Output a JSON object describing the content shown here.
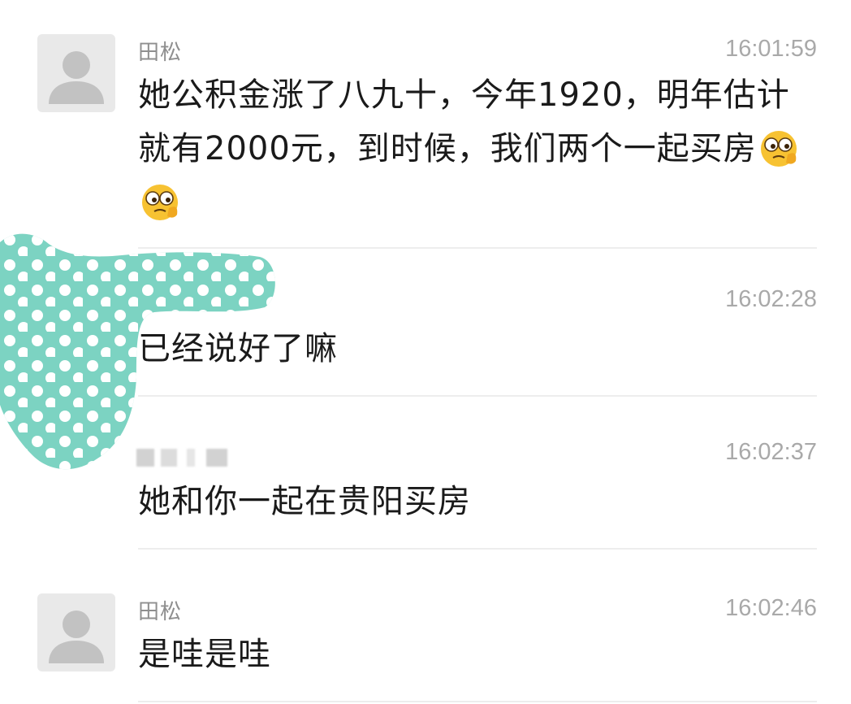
{
  "messages": [
    {
      "sender": "田松",
      "time": "16:01:59",
      "text": "她公积金涨了八九十，今年1920，明年估计就有2000元，到时候，我们两个一起买房"
    },
    {
      "sender": "",
      "time": "16:02:28",
      "text": "已经说好了嘛"
    },
    {
      "sender": "",
      "time": "16:02:37",
      "text": "她和你一起在贵阳买房"
    },
    {
      "sender": "田松",
      "time": "16:02:46",
      "text": "是哇是哇"
    }
  ],
  "icons": {
    "avatar": "default-person-avatar-icon",
    "emoji": "peeking-face-emoji-icon",
    "redaction": "polka-dot-sticker-icon"
  },
  "colors": {
    "sticker": "#7cd3c2",
    "avatar_bg": "#e9e9e9",
    "avatar_fg": "#c2c2c2",
    "time": "#a9a9a9",
    "sender": "#8f8f8f"
  }
}
